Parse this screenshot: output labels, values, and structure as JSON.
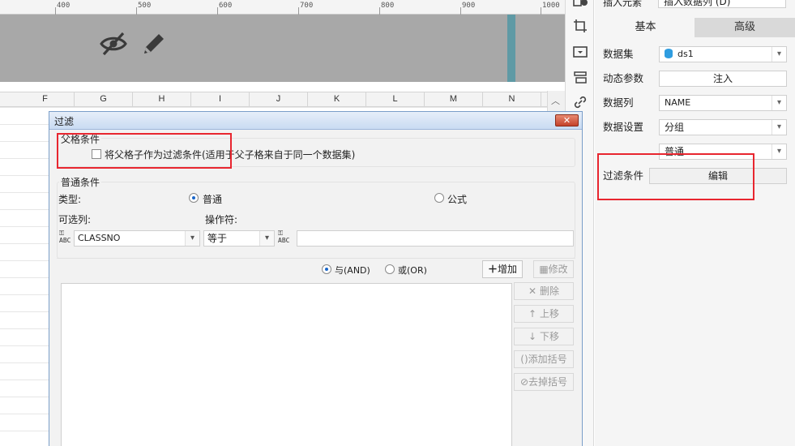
{
  "ruler": {
    "ticks": [
      "400",
      "500",
      "600",
      "700",
      "800",
      "900",
      "1000"
    ]
  },
  "grid": {
    "columns": [
      "F",
      "G",
      "H",
      "I",
      "J",
      "K",
      "L",
      "M",
      "N"
    ]
  },
  "panel": {
    "insert_label": "插入元素",
    "insert_value": "插入数据列 (D)",
    "tab_basic": "基本",
    "tab_advanced": "高级",
    "dataset_label": "数据集",
    "dataset_value": "ds1",
    "dyn_param_label": "动态参数",
    "dyn_param_button": "注入",
    "data_col_label": "数据列",
    "data_col_value": "NAME",
    "data_setting_label": "数据设置",
    "data_setting_value": "分组",
    "data_setting_sub_value": "普通",
    "filter_label": "过滤条件",
    "filter_button": "编辑"
  },
  "dialog": {
    "title": "过滤",
    "close_icon": "close-icon",
    "parent_group_title": "父格条件",
    "parent_checkbox_label": "将父格子作为过滤条件(适用于父子格来自于同一个数据集)",
    "parent_checked": false,
    "normal_group_title": "普通条件",
    "type_label": "类型:",
    "type_normal": "普通",
    "type_formula": "公式",
    "type_selected": "普通",
    "optional_col_label": "可选列:",
    "operator_label": "操作符:",
    "column_value": "CLASSNO",
    "operator_value": "等于",
    "value_input": "",
    "and_label": "与(AND)",
    "or_label": "或(OR)",
    "logic_selected": "与(AND)",
    "add_button": "增加",
    "modify_button": "修改",
    "delete_button": "删除",
    "up_button": "上移",
    "down_button": "下移",
    "add_bracket_button": "添加括号",
    "remove_bracket_button": "去掉括号"
  },
  "colors": {
    "highlight": "#e8262f",
    "accent": "#1a66c8",
    "dataset_icon": "#2f9de0",
    "preview_bg": "#a8a8a8",
    "marker": "#5f9aa5"
  }
}
